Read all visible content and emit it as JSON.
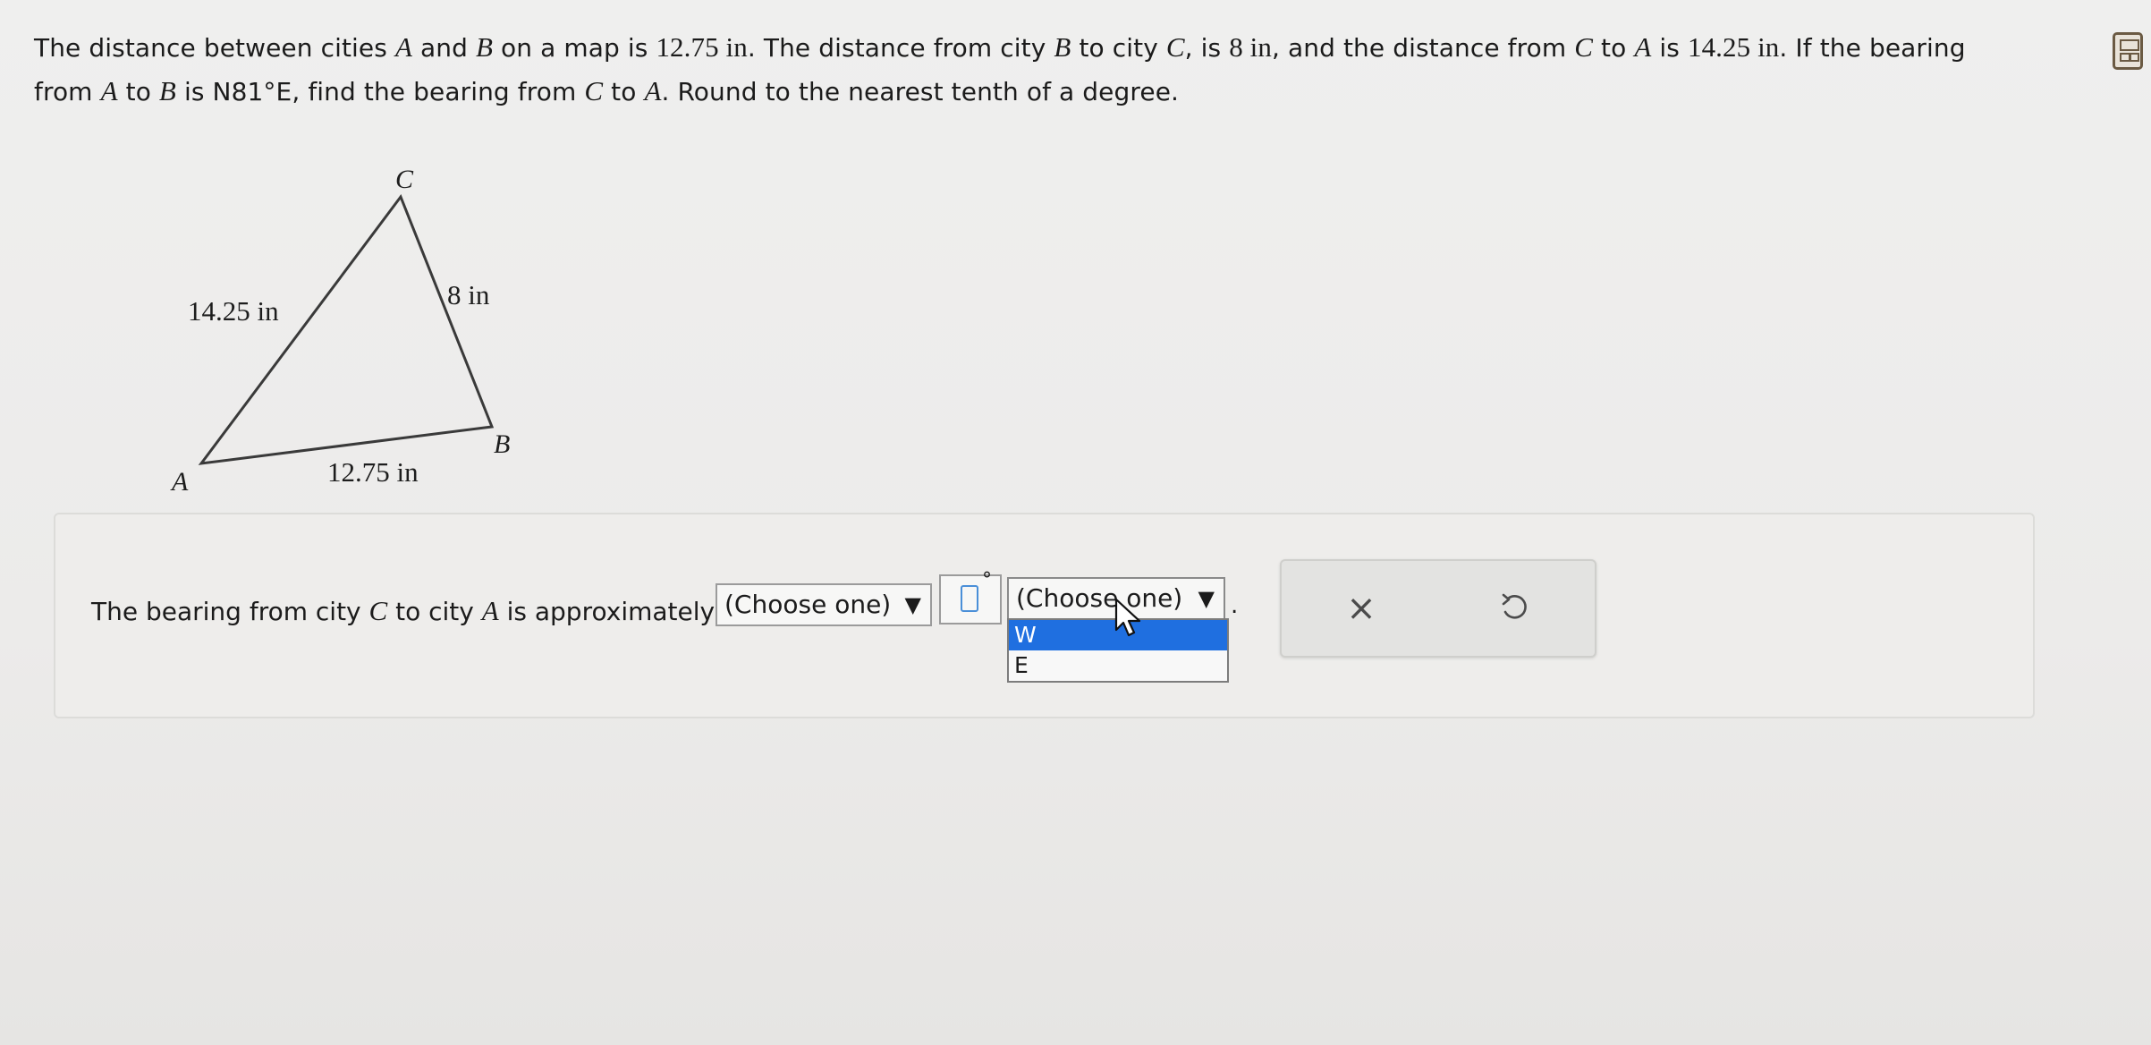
{
  "problem": {
    "t1": "The distance between cities ",
    "A": "A",
    "and": " and ",
    "B": "B",
    "t2": " on a map is ",
    "d_ab": "12.75 in",
    "t3": ". The distance from city ",
    "t4": " to city ",
    "C": "C",
    "t5": ", is ",
    "d_bc": "8 in",
    "t6": ", and the distance from ",
    "t7": " to ",
    "t8": " is ",
    "d_ca": "14.25 in",
    "t9": ". If the bearing",
    "l2a": "from ",
    "l2b": " is ",
    "bearing": "N81°E",
    "l2c": ", find the bearing from ",
    "l2d": ". Round to the nearest tenth of a degree."
  },
  "figure": {
    "vertex_a": "A",
    "vertex_b": "B",
    "vertex_c": "C",
    "side_ca": "14.25 in",
    "side_bc": "8 in",
    "side_ab": "12.75 in"
  },
  "answer": {
    "prefix": "The bearing from city ",
    "C": "C",
    "mid": " to city ",
    "A": "A",
    "suffix": " is approximately",
    "select1_value": "(Choose one)",
    "select1_arrow": "▼",
    "degree_symbol": "°",
    "select2_value": "(Choose one)",
    "select2_arrow": "▼",
    "options": [
      "W",
      "E"
    ],
    "period": "."
  },
  "actions": {
    "clear_symbol": "×"
  },
  "colors": {
    "accent": "#1f6fe0",
    "input_focus": "#4a8fd8"
  },
  "icons": [
    "calculator-icon",
    "undo-icon",
    "close-icon",
    "mouse-cursor-icon"
  ]
}
